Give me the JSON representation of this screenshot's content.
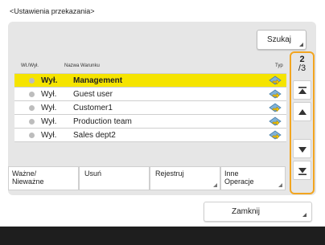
{
  "title": "<Ustawienia przekazania>",
  "search_label": "Szukaj",
  "columns": {
    "sel": "Wł./Wył.",
    "name": "Nazwa Warunku",
    "type": "Typ"
  },
  "rows": [
    {
      "status": "Wył.",
      "name": "Management",
      "selected": true,
      "type_icon": "forward-type-icon"
    },
    {
      "status": "Wył.",
      "name": "Guest user",
      "selected": false,
      "type_icon": "forward-type-icon"
    },
    {
      "status": "Wył.",
      "name": "Customer1",
      "selected": false,
      "type_icon": "forward-type-icon"
    },
    {
      "status": "Wył.",
      "name": "Production team",
      "selected": false,
      "type_icon": "forward-type-icon"
    },
    {
      "status": "Wył.",
      "name": "Sales dept2",
      "selected": false,
      "type_icon": "forward-type-icon"
    }
  ],
  "buttons": {
    "toggle": [
      "Ważne/",
      "Nieważne"
    ],
    "delete": "Usuń",
    "register": "Rejestruj",
    "other": [
      "Inne",
      "Operacje"
    ]
  },
  "pager": {
    "current": "2",
    "total": "/3"
  },
  "close_label": "Zamknij",
  "colors": {
    "selected": "#f5e400",
    "accent": "#f2a520"
  }
}
